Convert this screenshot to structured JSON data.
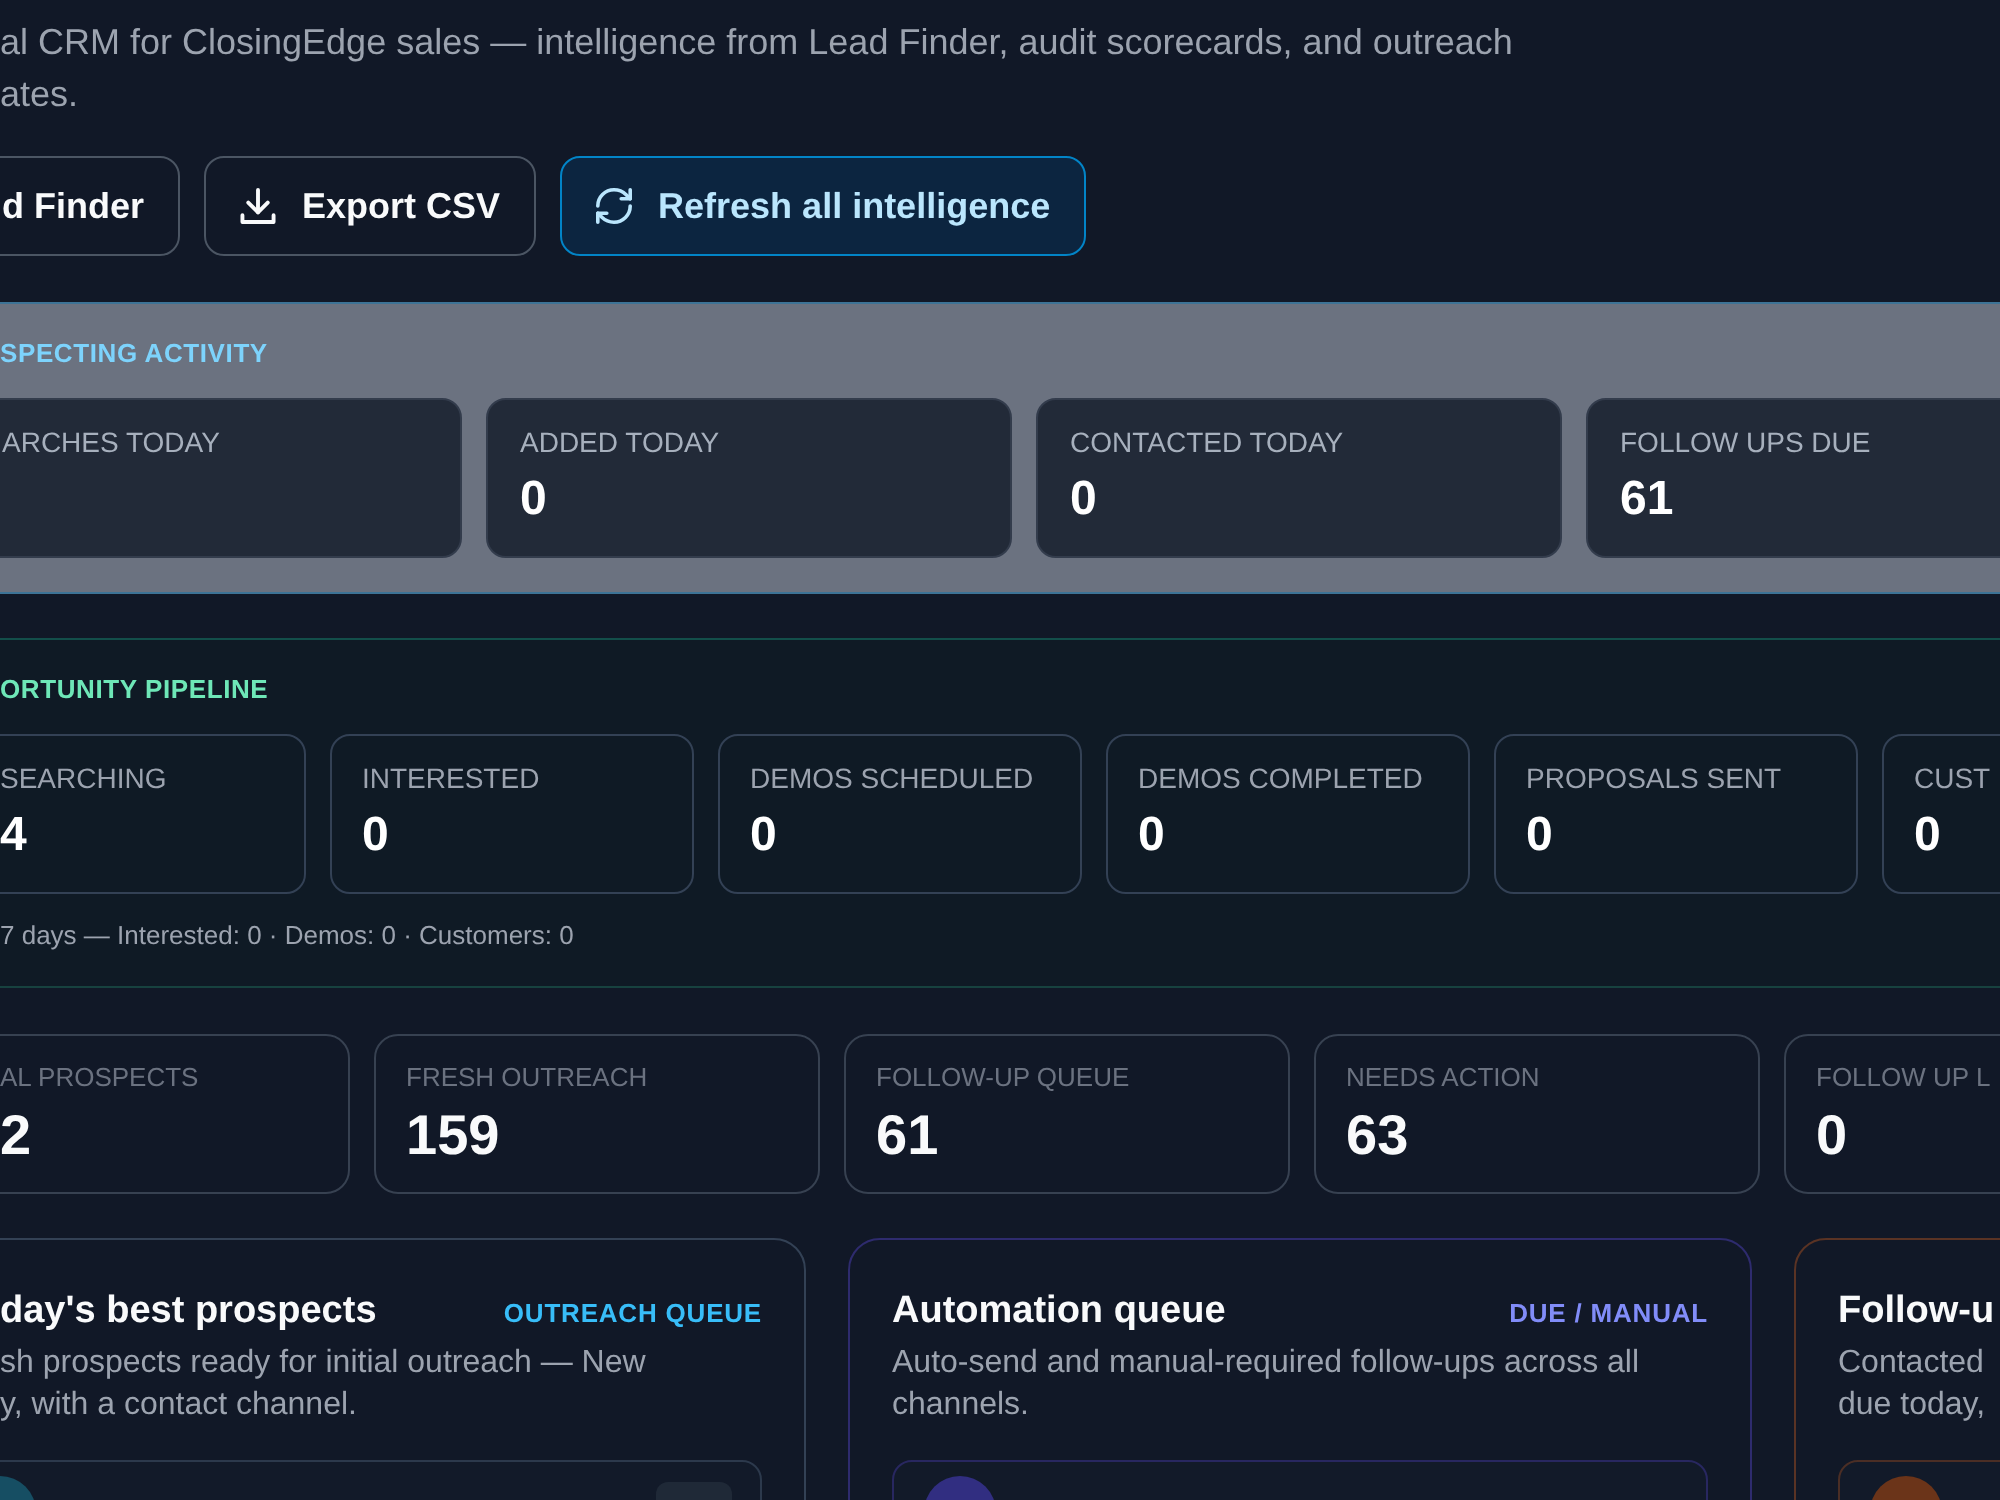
{
  "header": {
    "description_lines": [
      "al CRM for ClosingEdge sales — intelligence from Lead Finder, audit scorecards, and outreach",
      "ates."
    ],
    "buttons": [
      {
        "kind": "link",
        "label": "d Finder"
      },
      {
        "kind": "export",
        "label": "Export CSV"
      },
      {
        "kind": "refresh",
        "label": "Refresh all intelligence"
      }
    ]
  },
  "activity": {
    "title": "SPECTING ACTIVITY",
    "cards": [
      {
        "label": "ARCHES TODAY"
      },
      {
        "label": "ADDED TODAY",
        "value": "0"
      },
      {
        "label": "CONTACTED TODAY",
        "value": "0"
      },
      {
        "label": "FOLLOW UPS DUE",
        "value": "61"
      }
    ]
  },
  "pipeline": {
    "title": "ORTUNITY PIPELINE",
    "stages": [
      {
        "label": "SEARCHING",
        "value": "4"
      },
      {
        "label": "INTERESTED",
        "value": "0"
      },
      {
        "label": "DEMOS SCHEDULED",
        "value": "0"
      },
      {
        "label": "DEMOS COMPLETED",
        "value": "0"
      },
      {
        "label": "PROPOSALS SENT",
        "value": "0"
      },
      {
        "label": "CUST",
        "value": "0"
      }
    ],
    "note": "7 days — Interested: 0 · Demos: 0 · Customers: 0"
  },
  "summary": {
    "cards": [
      {
        "label": "AL PROSPECTS",
        "value": "2"
      },
      {
        "label": "FRESH OUTREACH",
        "value": "159"
      },
      {
        "label": "FOLLOW-UP QUEUE",
        "value": "61"
      },
      {
        "label": "NEEDS ACTION",
        "value": "63"
      },
      {
        "label": "FOLLOW UP L",
        "value": "0"
      }
    ]
  },
  "panels": [
    {
      "title": "day's best prospects",
      "color": "#334155",
      "tag": {
        "label": "OUTREACH QUEUE",
        "color": "#38bdf8"
      },
      "description_lines": [
        "sh prospects ready for initial outreach — New",
        "y, with a contact channel."
      ],
      "rows": [
        {
          "kind": "chip",
          "color": "#164e63"
        }
      ]
    },
    {
      "title": "Automation queue",
      "color": "#2e2b6e",
      "tag": {
        "label": "DUE / MANUAL",
        "color": "#818cf8"
      },
      "description_lines": [
        "Auto-send and manual-required follow-ups across all",
        "channels."
      ],
      "rows": [
        {
          "kind": "plain",
          "color": "#312e81"
        }
      ]
    },
    {
      "title": "Follow-u",
      "color": "#5a3324",
      "description_lines": [
        "Contacted",
        "due today,"
      ],
      "rows": [
        {
          "kind": "plain",
          "color": "#6b3419"
        }
      ]
    }
  ]
}
